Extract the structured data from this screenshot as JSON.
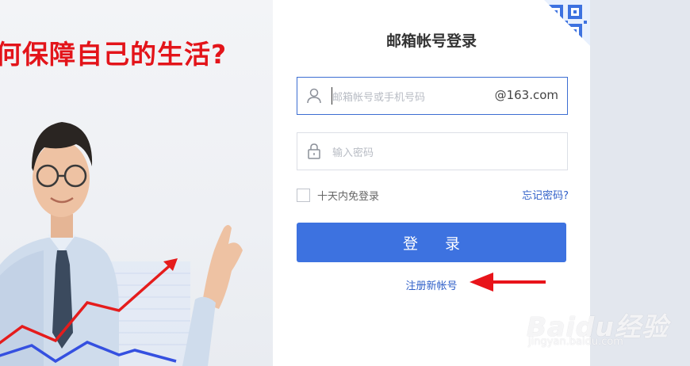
{
  "banner": {
    "headline": "何保障自己的生活?"
  },
  "login": {
    "title": "邮箱帐号登录",
    "email_placeholder": "邮箱帐号或手机号码",
    "email_suffix": "@163.com",
    "password_placeholder": "输入密码",
    "remember_label": "十天内免登录",
    "forgot_link": "忘记密码?",
    "login_button": "登 录",
    "register_link": "注册新帐号"
  },
  "watermark": {
    "logo_text": "Baidu经验",
    "sub_text": "jingyan.baidu.com"
  },
  "colors": {
    "accent": "#3d72e0",
    "link": "#2f5fc8",
    "headline": "#e3141a",
    "annotation_arrow": "#e8141a"
  },
  "icons": [
    "user-icon",
    "lock-icon",
    "qr-code-icon",
    "arrow-annotation-icon"
  ]
}
